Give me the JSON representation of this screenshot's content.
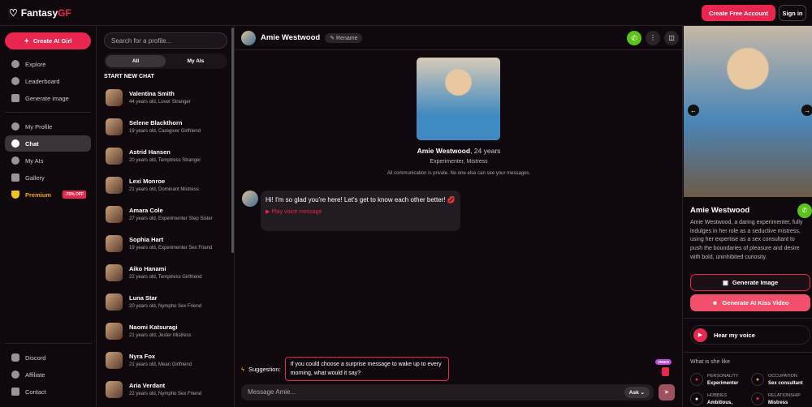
{
  "header": {
    "brand_a": "Fantasy",
    "brand_b": "GF",
    "create_account": "Create Free Account",
    "sign_in": "Sign in"
  },
  "sidebar": {
    "create": "Create AI Girl",
    "items": [
      {
        "label": "Explore"
      },
      {
        "label": "Leaderboard"
      },
      {
        "label": "Generate image"
      }
    ],
    "items2": [
      {
        "label": "My Profile"
      },
      {
        "label": "Chat"
      },
      {
        "label": "My AIs"
      },
      {
        "label": "Gallery"
      },
      {
        "label": "Premium"
      }
    ],
    "premium_badge": "-75% OFF",
    "footer": [
      {
        "label": "Discord"
      },
      {
        "label": "Affiliate"
      },
      {
        "label": "Contact"
      }
    ]
  },
  "list": {
    "search_placeholder": "Search for a profile...",
    "tabs": [
      "All",
      "My AIs"
    ],
    "heading": "START NEW CHAT",
    "chats": [
      {
        "name": "Valentina Smith",
        "desc": "44 years old, Lover Stranger"
      },
      {
        "name": "Selene Blackthorn",
        "desc": "19 years old, Caregiver Girlfriend"
      },
      {
        "name": "Astrid Hansen",
        "desc": "20 years old, Temptress Stranger"
      },
      {
        "name": "Lexi Monroe",
        "desc": "21 years old, Dominant Mistress"
      },
      {
        "name": "Amara Cole",
        "desc": "27 years old, Experimenter Step Sister"
      },
      {
        "name": "Sophia Hart",
        "desc": "19 years old, Experimenter Sex Friend"
      },
      {
        "name": "Aiko Hanami",
        "desc": "22 years old, Temptress Girlfriend"
      },
      {
        "name": "Luna Star",
        "desc": "20 years old, Nympho Sex Friend"
      },
      {
        "name": "Naomi Katsuragi",
        "desc": "21 years old, Jester Mistress"
      },
      {
        "name": "Nyra Fox",
        "desc": "21 years old, Mean Girlfriend"
      },
      {
        "name": "Aria Verdant",
        "desc": "22 years old, Nympho Sex Friend"
      }
    ]
  },
  "chat": {
    "name": "Amie Westwood",
    "rename": "Rename",
    "age": ", 24 years",
    "roles": "Experimenter, Mistress",
    "privacy": "All communication is private. No one else can see your messages.",
    "message": "Hi! I'm so glad you're here! Let's get to know each other better! 💋",
    "voice": "Play voice message",
    "suggestion_label": "Suggestion:",
    "suggestion": "If you could choose a surprise message to wake up to every morning, what would it say?",
    "video_badge": "VIDEO",
    "input_placeholder": "Message Amie...",
    "ask": "Ask"
  },
  "profile": {
    "name": "Amie Westwood",
    "bio": "Amie Westwood, a daring experimenter, fully indulges in her role as a seductive mistress, using her expertise as a sex consultant to push the boundaries of pleasure and desire with bold, uninhibited curiosity.",
    "gen_image": "Generate Image",
    "gen_video": "Generate AI Kiss Video",
    "voice": "Hear my voice",
    "what": "What is she like",
    "attrs": [
      {
        "k": "PERSONALITY",
        "v": "Experimenter"
      },
      {
        "k": "OCCUPATION",
        "v": "Sex consultant"
      },
      {
        "k": "HOBBIES",
        "v": "Ambitious,"
      },
      {
        "k": "RELATIONSHIP",
        "v": "Mistress"
      }
    ]
  },
  "colors": {
    "accent": "#e8264f",
    "call": "#5cc21a"
  }
}
